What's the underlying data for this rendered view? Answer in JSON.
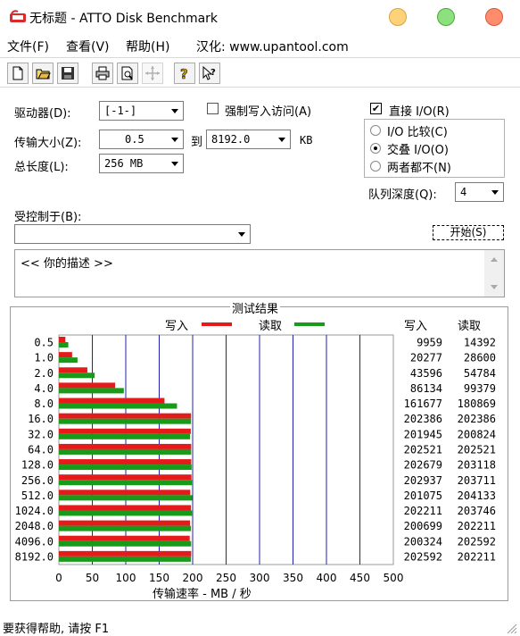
{
  "window": {
    "title": "无标题 - ATTO Disk Benchmark"
  },
  "menu": {
    "file": "文件(F)",
    "view": "查看(V)",
    "help": "帮助(H)",
    "localized": "汉化: www.upantool.com"
  },
  "toolbar": {
    "icons": [
      "new-icon",
      "open-icon",
      "save-icon",
      "print-icon",
      "print-preview-icon",
      "move-icon",
      "help-icon",
      "context-help-icon"
    ]
  },
  "form": {
    "drive_label": "驱动器(D):",
    "drive_value": "[-1-]",
    "transfer_label": "传输大小(Z):",
    "transfer_from": "0.5",
    "transfer_to_label": "到",
    "transfer_to": "8192.0",
    "transfer_unit": "KB",
    "total_label": "总长度(L):",
    "total_value": "256 MB",
    "force_write_label": "强制写入访问(A)",
    "direct_io_label": "直接 I/O(R)",
    "direct_io_checked": "✔",
    "radio_io_compare": "I/O 比较(C)",
    "radio_overlap": "交叠 I/O(O)",
    "radio_neither": "两者都不(N)",
    "queue_label": "队列深度(Q):",
    "queue_value": "4",
    "controlled_label": "受控制于(B):",
    "controlled_value": "",
    "start_button": "开始(S)",
    "description": "<< 你的描述 >>"
  },
  "results": {
    "title": "测试结果",
    "write_legend": "写入",
    "read_legend": "读取",
    "write_header": "写入",
    "read_header": "读取",
    "xlabel": "传输速率 - MB / 秒",
    "colors": {
      "write": "#e51a1a",
      "read": "#1a9a1a",
      "grid": "#1f1fb4"
    }
  },
  "chart_data": {
    "type": "bar",
    "orientation": "horizontal",
    "categories": [
      "0.5",
      "1.0",
      "2.0",
      "4.0",
      "8.0",
      "16.0",
      "32.0",
      "64.0",
      "128.0",
      "256.0",
      "512.0",
      "1024.0",
      "2048.0",
      "4096.0",
      "8192.0"
    ],
    "series": [
      {
        "name": "写入",
        "values": [
          9959,
          20277,
          43596,
          86134,
          161677,
          202386,
          201945,
          202521,
          202679,
          202937,
          201075,
          202211,
          200699,
          200324,
          202592
        ]
      },
      {
        "name": "读取",
        "values": [
          14392,
          28600,
          54784,
          99379,
          180869,
          202386,
          200824,
          202521,
          203118,
          203711,
          204133,
          203746,
          202211,
          202592,
          202211
        ]
      }
    ],
    "bar_values_mbps": {
      "write": [
        9.7,
        19.8,
        42.6,
        84.1,
        157.9,
        197.6,
        197.2,
        197.8,
        197.9,
        198.2,
        196.4,
        197.5,
        196.0,
        195.6,
        197.8
      ],
      "read": [
        14.1,
        27.9,
        53.5,
        97.1,
        176.6,
        197.6,
        196.1,
        197.8,
        198.4,
        198.9,
        199.3,
        199.0,
        197.5,
        197.8,
        197.5
      ]
    },
    "xticks": [
      "0",
      "50",
      "100",
      "150",
      "200",
      "250",
      "300",
      "350",
      "400",
      "450",
      "500"
    ],
    "xlim": [
      0,
      500
    ],
    "grid": true
  },
  "status": {
    "text": "要获得帮助, 请按 F1"
  }
}
